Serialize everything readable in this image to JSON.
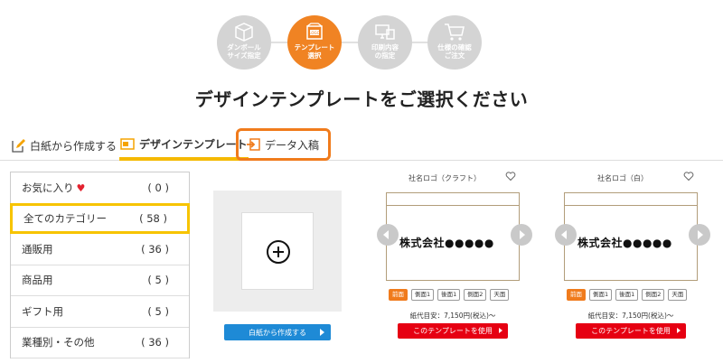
{
  "steps": [
    {
      "label": "ダンボール\nサイズ指定",
      "icon": "box-icon",
      "active": false
    },
    {
      "label": "テンプレート\n選択",
      "icon": "logo-template-icon",
      "active": true
    },
    {
      "label": "印刷内容\nの指定",
      "icon": "computer-icon",
      "active": false
    },
    {
      "label": "仕様の確認\nご注文",
      "icon": "cart-icon",
      "active": false
    }
  ],
  "page_title": "デザインテンプレートをご選択ください",
  "tabs": {
    "blank": "白紙から作成する",
    "design": "デザインテンプレート",
    "upload": "データ入稿"
  },
  "categories": [
    {
      "label": "お気に入り",
      "count": "( 0 )",
      "heart": true
    },
    {
      "label": "全てのカテゴリー",
      "count": "( 58 )",
      "selected": true
    },
    {
      "label": "通販用",
      "count": "( 36 )"
    },
    {
      "label": "商品用",
      "count": "( 5 )"
    },
    {
      "label": "ギフト用",
      "count": "( 5 )"
    },
    {
      "label": "業種別・その他",
      "count": "( 36 )"
    }
  ],
  "blank_card": {
    "button": "白紙から作成する"
  },
  "templates": [
    {
      "name": "社名ロゴ（クラフト）",
      "company": "株式会社●●●●●",
      "faces": [
        "前面",
        "側面1",
        "後面1",
        "側面2",
        "天面"
      ],
      "price": "紙代目安：7,150円(税込)～",
      "button": "このテンプレートを使用"
    },
    {
      "name": "社名ロゴ（白）",
      "company": "株式会社●●●●●",
      "faces": [
        "前面",
        "側面1",
        "後面1",
        "側面2",
        "天面"
      ],
      "price": "紙代目安：7,150円(税込)～",
      "button": "このテンプレートを使用"
    }
  ],
  "colors": {
    "accent": "#f08323",
    "step_inactive": "#d4d4d4",
    "selected_border": "#f7c400",
    "cta_red": "#e60012",
    "cta_blue": "#1e8ad6"
  }
}
